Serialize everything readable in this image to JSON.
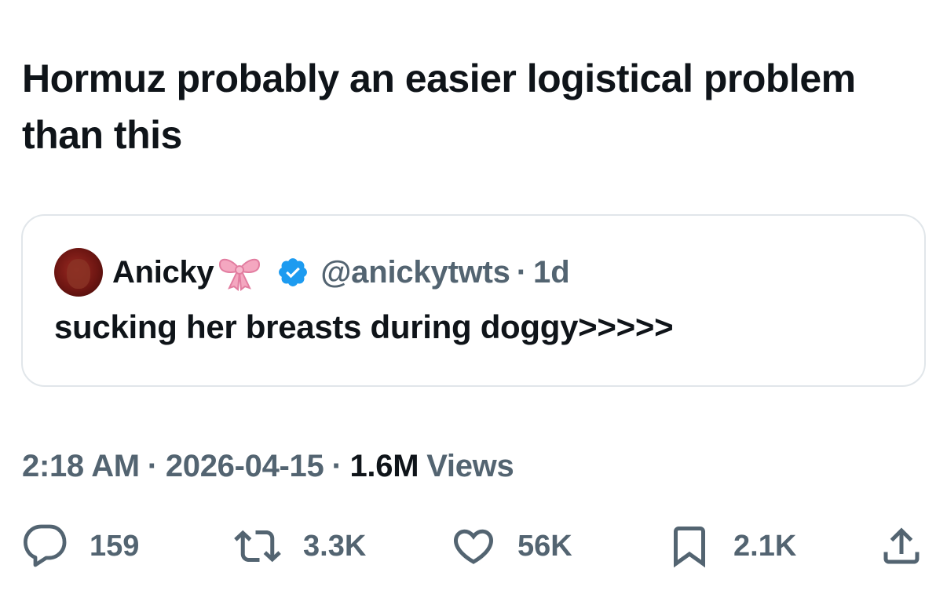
{
  "tweet": {
    "text": "Hormuz probably an easier logistical problem than this"
  },
  "quoted_tweet": {
    "author_name": "Anicky",
    "author_emoji": "🎀",
    "verified": true,
    "handle": "@anickytwts",
    "separator": "·",
    "age": "1d",
    "text": "sucking her breasts during doggy>>>>>"
  },
  "meta": {
    "time": "2:18 AM",
    "separator": "·",
    "date": "2026-04-15",
    "views_count": "1.6M",
    "views_label": "Views"
  },
  "actions": {
    "replies": "159",
    "reposts": "3.3K",
    "likes": "56K",
    "bookmarks": "2.1K"
  },
  "colors": {
    "text": "#0f1419",
    "secondary": "#536471",
    "verified": "#1d9bf0",
    "border": "#e1e6ea",
    "bow": "#f4a7c0"
  },
  "icons": [
    "reply-icon",
    "repost-icon",
    "like-icon",
    "bookmark-icon",
    "share-icon",
    "verified-badge-icon",
    "bow-emoji-icon"
  ]
}
